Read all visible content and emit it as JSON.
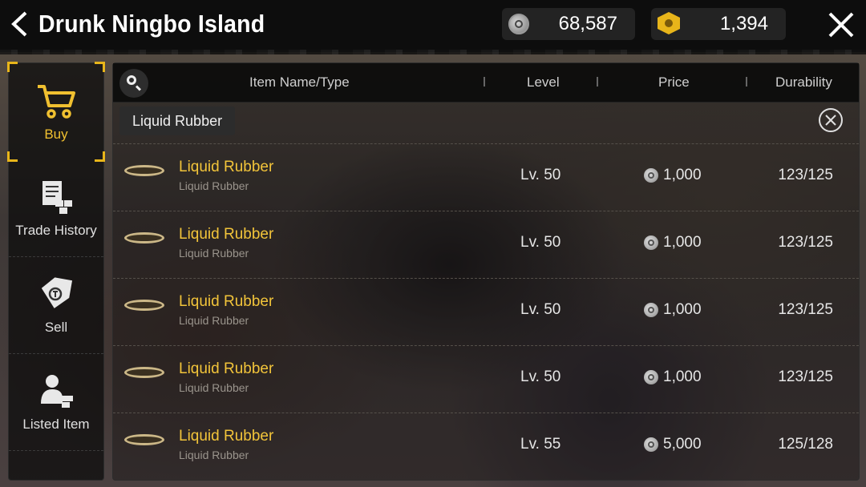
{
  "header": {
    "title": "Drunk Ningbo Island",
    "silver": "68,587",
    "gold": "1,394"
  },
  "sidebar": {
    "items": [
      {
        "label": "Buy",
        "icon": "cart-icon",
        "active": true
      },
      {
        "label": "Trade History",
        "icon": "trade-history-icon"
      },
      {
        "label": "Sell",
        "icon": "price-tag-icon"
      },
      {
        "label": "Listed Item",
        "icon": "listed-item-icon"
      }
    ]
  },
  "table": {
    "columns": [
      "Item Name/Type",
      "Level",
      "Price",
      "Durability"
    ],
    "filter": "Liquid Rubber",
    "rows": [
      {
        "name": "Liquid Rubber",
        "type": "Liquid Rubber",
        "level": "Lv. 50",
        "price": "1,000",
        "durability": "123/125"
      },
      {
        "name": "Liquid Rubber",
        "type": "Liquid Rubber",
        "level": "Lv. 50",
        "price": "1,000",
        "durability": "123/125"
      },
      {
        "name": "Liquid Rubber",
        "type": "Liquid Rubber",
        "level": "Lv. 50",
        "price": "1,000",
        "durability": "123/125"
      },
      {
        "name": "Liquid Rubber",
        "type": "Liquid Rubber",
        "level": "Lv. 50",
        "price": "1,000",
        "durability": "123/125"
      },
      {
        "name": "Liquid Rubber",
        "type": "Liquid Rubber",
        "level": "Lv. 55",
        "price": "5,000",
        "durability": "125/128"
      }
    ]
  },
  "colors": {
    "accent": "#f2c43a",
    "item_name": "#f2c43a"
  }
}
